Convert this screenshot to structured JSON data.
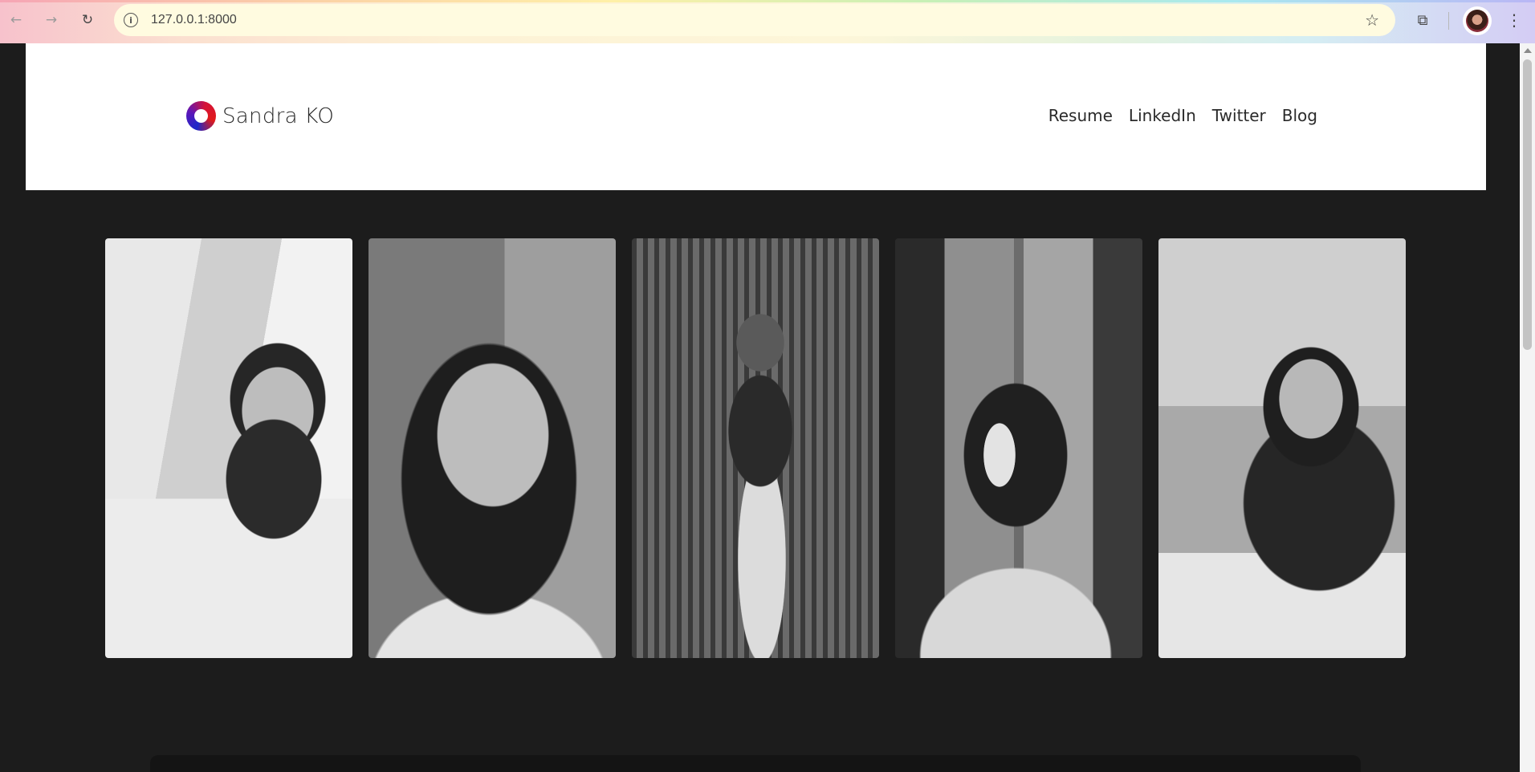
{
  "browser": {
    "url": "127.0.0.1:8000",
    "icons": {
      "back": "back-arrow-icon",
      "forward": "forward-arrow-icon",
      "reload": "reload-icon",
      "site_info": "info-icon",
      "bookmark": "star-icon",
      "extensions": "puzzle-icon",
      "menu": "kebab-menu-icon"
    }
  },
  "site": {
    "brand_name": "Sandra KO",
    "nav": [
      "Resume",
      "LinkedIn",
      "Twitter",
      "Blog"
    ]
  },
  "colors": {
    "page_background": "#1c1c1c",
    "header_background": "#ffffff",
    "logo_gradient": [
      "#1d27c9",
      "#d41238"
    ]
  }
}
